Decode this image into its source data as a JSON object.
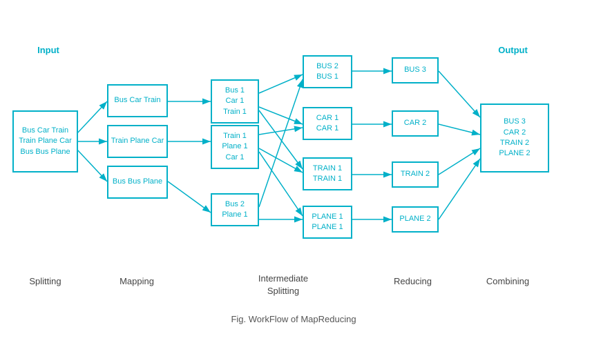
{
  "title": "Fig. WorkFlow of MapReducing",
  "labels": {
    "input": "Input",
    "output": "Output",
    "splitting": "Splitting",
    "mapping": "Mapping",
    "intermediate_splitting": "Intermediate\nSplitting",
    "reducing": "Reducing",
    "combining": "Combining"
  },
  "boxes": {
    "input": "Bus Car Train\nTrain Plane Car\nBus Bus Plane",
    "map1": "Bus Car Train",
    "map2": "Train Plane Car",
    "map3": "Bus Bus Plane",
    "split1": "Bus 1\nCar 1\nTrain 1",
    "split2": "Train 1\nPlane 1\nCar 1",
    "split3": "Bus 2\nPlane 1",
    "inter1": "BUS 2\nBUS 1",
    "inter2": "CAR 1\nCAR 1",
    "inter3": "TRAIN 1\nTRAIN 1",
    "inter4": "PLANE 1\nPLANE 1",
    "reduce1": "BUS 3",
    "reduce2": "CAR 2",
    "reduce3": "TRAIN 2",
    "reduce4": "PLANE 2",
    "output": "BUS 3\nCAR 2\nTRAIN 2\nPLANE 2"
  }
}
